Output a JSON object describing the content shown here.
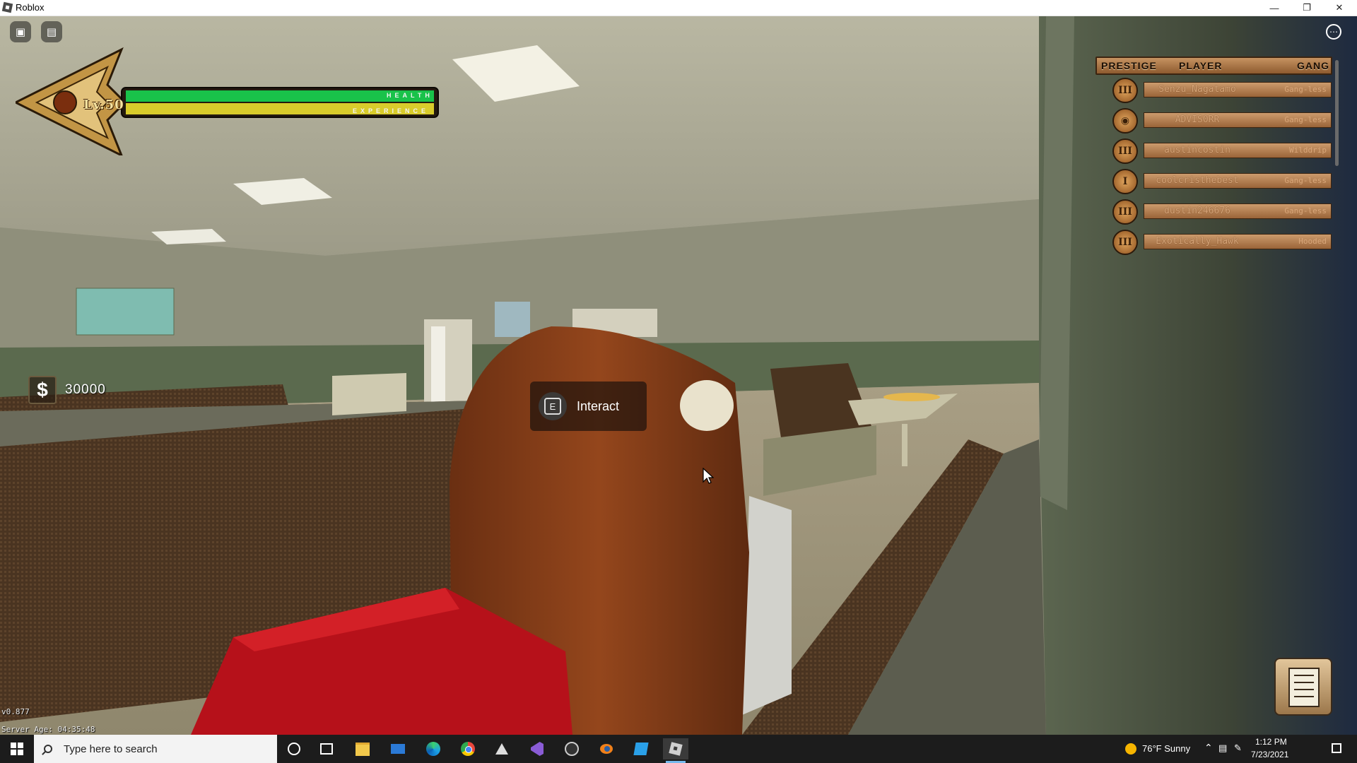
{
  "window": {
    "title": "Roblox"
  },
  "hud": {
    "level_text": "Lv.50",
    "health_label": "HEALTH",
    "experience_label": "EXPERIENCE",
    "health_fraction": 1.0,
    "experience_fraction": 1.0,
    "money": {
      "symbol": "$",
      "amount": "30000"
    },
    "interact": {
      "key": "E",
      "label": "Interact"
    },
    "version": "v0.877",
    "server_age": "Server Age: 04:35:48"
  },
  "playerlist": {
    "headers": {
      "prestige": "PRESTIGE",
      "player": "PLAYER",
      "gang": "GANG"
    },
    "rows": [
      {
        "badge": "III",
        "name": "Senzu_Nagatamo",
        "gang": "Gang-less"
      },
      {
        "badge": "◉",
        "name": "ADVIS0RR",
        "gang": "Gang-less"
      },
      {
        "badge": "III",
        "name": "austincostin",
        "gang": "Wilddrip"
      },
      {
        "badge": "I",
        "name": "coolcristhebest",
        "gang": "Gang-less"
      },
      {
        "badge": "III",
        "name": "dustin246676",
        "gang": "Gang-less"
      },
      {
        "badge": "III",
        "name": "Exotically_Hawk",
        "gang": "Hooded"
      }
    ]
  },
  "taskbar": {
    "search_placeholder": "Type here to search",
    "weather": "76°F  Sunny",
    "time": "1:12 PM",
    "date": "7/23/2021",
    "apps": [
      "cortana-icon",
      "task-view-icon",
      "file-explorer-icon",
      "mail-icon",
      "edge-icon",
      "chrome-icon",
      "unity-icon",
      "visual-studio-icon",
      "obs-icon",
      "blender-icon",
      "roblox-studio-icon",
      "roblox-player-icon"
    ]
  },
  "colors": {
    "health_green": "#19c24a",
    "xp_yellow": "#d9cc2b",
    "wood_bar": "#b07a48",
    "taskbar_bg": "#1c1c1c"
  }
}
